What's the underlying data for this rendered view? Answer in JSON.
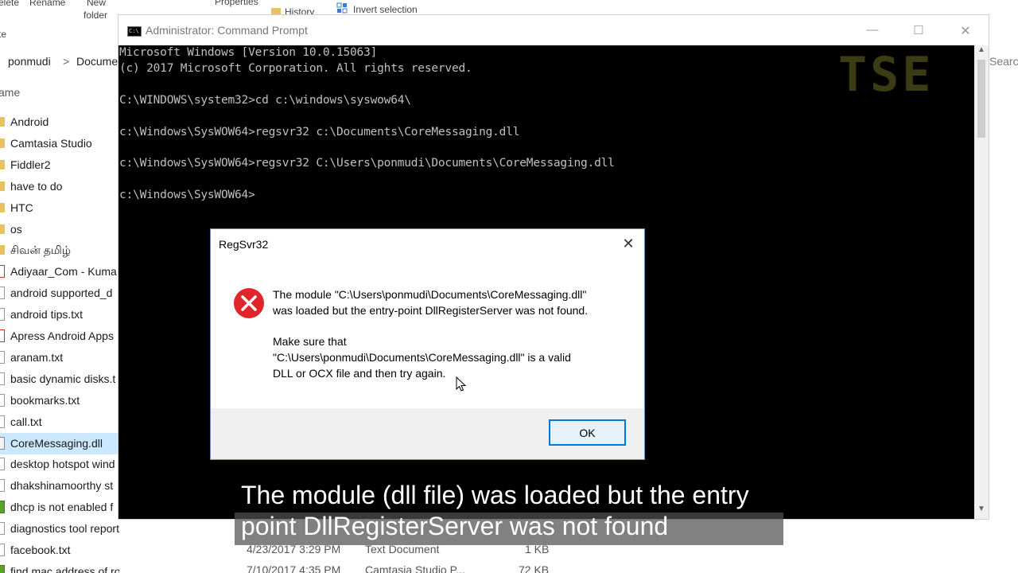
{
  "ribbon": {
    "delete_frag": "elete",
    "rename": "Rename",
    "new_folder_line1": "New",
    "new_folder_line2": "folder",
    "properties": "Properties",
    "history": "History",
    "invert_selection": "Invert selection",
    "left_frag": "te"
  },
  "address": {
    "crumb1": "ponmudi",
    "sep": ">",
    "crumb2": "Docume"
  },
  "search_frag": "Searc",
  "column_name_frag": "ame",
  "files": [
    {
      "name": "Android",
      "icon": "folder"
    },
    {
      "name": "Camtasia Studio",
      "icon": "folder"
    },
    {
      "name": "Fiddler2",
      "icon": "folder"
    },
    {
      "name": "have to do",
      "icon": "folder"
    },
    {
      "name": "HTC",
      "icon": "folder"
    },
    {
      "name": "os",
      "icon": "folder"
    },
    {
      "name": "சிவன் தமிழ்",
      "icon": "folder"
    },
    {
      "name": "Adiyaar_Com - Kuma",
      "icon": "pdf"
    },
    {
      "name": "android supported_d",
      "icon": "txt"
    },
    {
      "name": "android tips.txt",
      "icon": "txt"
    },
    {
      "name": "Apress Android Apps",
      "icon": "pdf"
    },
    {
      "name": "aranam.txt",
      "icon": "txt"
    },
    {
      "name": "basic dynamic disks.t",
      "icon": "txt"
    },
    {
      "name": "bookmarks.txt",
      "icon": "txt"
    },
    {
      "name": "call.txt",
      "icon": "txt"
    },
    {
      "name": "CoreMessaging.dll",
      "icon": "dll",
      "selected": true
    },
    {
      "name": "desktop hotspot wind",
      "icon": "txt"
    },
    {
      "name": "dhakshinamoorthy st",
      "icon": "txt"
    },
    {
      "name": "dhcp is not enabled f",
      "icon": "cam"
    },
    {
      "name": "diagnostics tool report.txt",
      "icon": "txt"
    },
    {
      "name": "facebook.txt",
      "icon": "txt"
    },
    {
      "name": "find mac address of router.camproj",
      "icon": "cam"
    }
  ],
  "details": {
    "row1": {
      "date": "4/23/2017 3:29 PM",
      "type": "Text Document",
      "size": "1 KB"
    },
    "row2": {
      "date": "7/10/2017 4:35 PM",
      "type": "Camtasia Studio P...",
      "size": "72 KB"
    }
  },
  "cmd": {
    "title": "Administrator: Command Prompt",
    "icon_label": "C:\\",
    "minimize": "—",
    "maximize": "☐",
    "close": "✕",
    "lines": [
      "Microsoft Windows [Version 10.0.15063]",
      "(c) 2017 Microsoft Corporation. All rights reserved.",
      "",
      "C:\\WINDOWS\\system32>cd c:\\windows\\syswow64\\",
      "",
      "c:\\Windows\\SysWOW64>regsvr32 c:\\Documents\\CoreMessaging.dll",
      "",
      "c:\\Windows\\SysWOW64>regsvr32 C:\\Users\\ponmudi\\Documents\\CoreMessaging.dll",
      "",
      "c:\\Windows\\SysWOW64>"
    ],
    "watermark": "TSE"
  },
  "dialog": {
    "title": "RegSvr32",
    "close": "✕",
    "message_line1": "The module \"C:\\Users\\ponmudi\\Documents\\CoreMessaging.dll\"",
    "message_line2": "was loaded but the entry-point DllRegisterServer was not found.",
    "message_line3": "Make sure that",
    "message_line4": "\"C:\\Users\\ponmudi\\Documents\\CoreMessaging.dll\" is a valid",
    "message_line5": "DLL or OCX file and then try again.",
    "ok_label": "OK"
  },
  "subtitle": {
    "line1": "The module (dll file) was loaded but the entry",
    "line2": "point DllRegisterServer was not found"
  }
}
